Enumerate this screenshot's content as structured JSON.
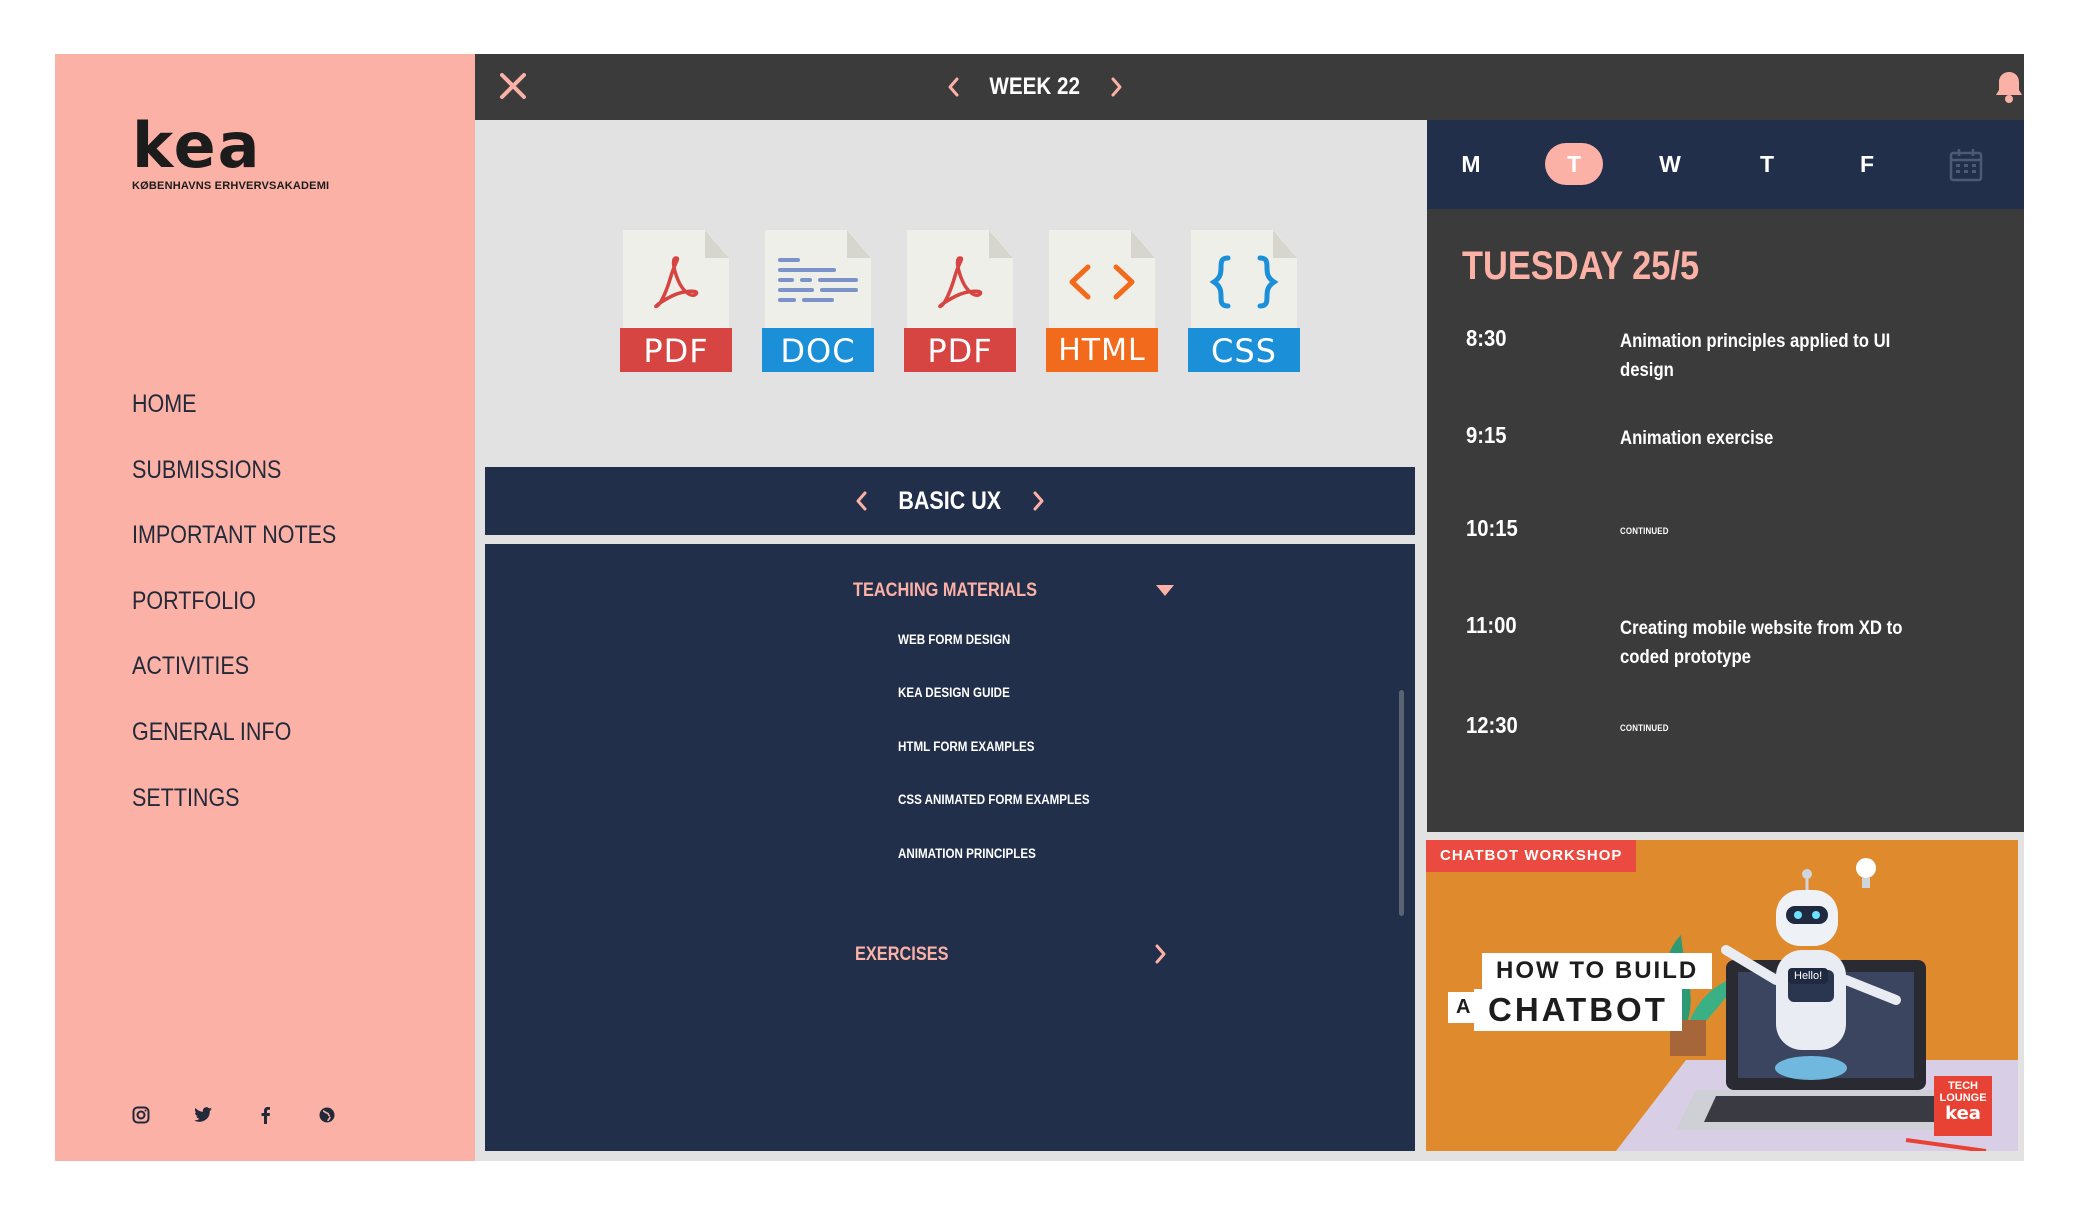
{
  "sidebar": {
    "logo_mark": "kea",
    "logo_sub": "KØBENHAVNS ERHVERVSAKADEMI",
    "nav": [
      "HOME",
      "SUBMISSIONS",
      "IMPORTANT NOTES",
      "PORTFOLIO",
      "ACTIVITIES",
      "GENERAL INFO",
      "SETTINGS"
    ],
    "social_icons": [
      "instagram-icon",
      "twitter-icon",
      "facebook-icon",
      "globe-icon"
    ]
  },
  "topbar": {
    "week_label": "WEEK 22",
    "icons": [
      "close-icon",
      "chevron-left-icon",
      "chevron-right-icon",
      "bell-icon"
    ]
  },
  "files": [
    {
      "type": "PDF",
      "color": "#d64541"
    },
    {
      "type": "DOC",
      "color": "#1b8fd8"
    },
    {
      "type": "PDF",
      "color": "#d64541"
    },
    {
      "type": "HTML",
      "color": "#f26a1b"
    },
    {
      "type": "CSS",
      "color": "#1b8fd8"
    }
  ],
  "course": {
    "label": "BASIC UX"
  },
  "materials": {
    "teaching_title": "TEACHING MATERIALS",
    "items": [
      "WEB FORM DESIGN",
      "KEA DESIGN GUIDE",
      "HTML FORM EXAMPLES",
      "CSS ANIMATED FORM EXAMPLES",
      "ANIMATION PRINCIPLES"
    ],
    "exercises_title": "EXERCISES"
  },
  "days": {
    "labels": [
      "M",
      "T",
      "W",
      "T",
      "F"
    ],
    "active_index": 1
  },
  "schedule": {
    "date_title": "TUESDAY 25/5",
    "slots": [
      {
        "time": "8:30",
        "title": "Animation principles applied to UI design"
      },
      {
        "time": "9:15",
        "title": "Animation exercise"
      },
      {
        "time": "10:15",
        "title": "CONTINUED"
      },
      {
        "time": "11:00",
        "title": "Creating mobile website from XD to coded prototype"
      },
      {
        "time": "12:30",
        "title": "CONTINUED"
      }
    ]
  },
  "banner": {
    "tag": "CHATBOT WORKSHOP",
    "line1": "HOW TO BUILD",
    "line2_prefix": "A",
    "line2": "CHATBOT",
    "bubble": "Hello!",
    "badge_top": "TECH LOUNGE",
    "badge_logo": "kea"
  },
  "colors": {
    "sidebar": "#fbb1a6",
    "navy": "#222f4b",
    "dark": "#3b3b3b",
    "accent": "#fbb1a6",
    "banner": "#e08a2e"
  }
}
